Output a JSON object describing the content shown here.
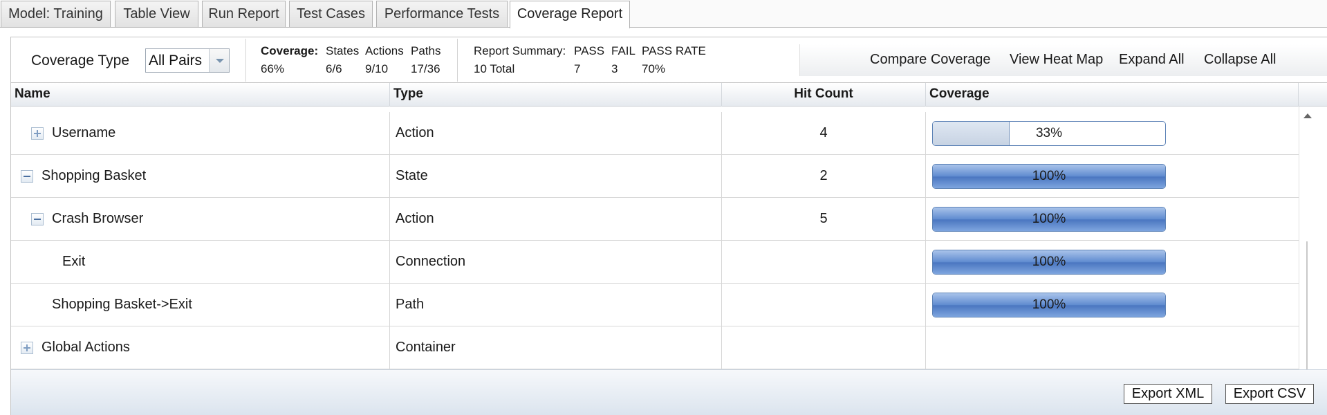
{
  "tabs": [
    {
      "label": "Model: Training"
    },
    {
      "label": "Table View"
    },
    {
      "label": "Run Report"
    },
    {
      "label": "Test Cases"
    },
    {
      "label": "Performance Tests"
    },
    {
      "label": "Coverage Report",
      "active": true
    }
  ],
  "toolbar": {
    "coverage_type_label": "Coverage Type",
    "coverage_type_value": "All Pairs",
    "coverage": {
      "title": "Coverage:",
      "overall": "66%",
      "states_label": "States",
      "states": "6/6",
      "actions_label": "Actions",
      "actions": "9/10",
      "paths_label": "Paths",
      "paths": "17/36"
    },
    "summary": {
      "title": "Report Summary:",
      "total": "10 Total",
      "pass_label": "PASS",
      "pass": "7",
      "fail_label": "FAIL",
      "fail": "3",
      "rate_label": "PASS RATE",
      "rate": "70%"
    },
    "actions": {
      "compare": "Compare Coverage",
      "heatmap": "View Heat Map",
      "expand": "Expand All",
      "collapse": "Collapse All"
    }
  },
  "grid": {
    "columns": {
      "name": "Name",
      "type": "Type",
      "hit": "Hit Count",
      "coverage": "Coverage"
    },
    "rows": [
      {
        "name": "Username",
        "type": "Action",
        "hit": "4",
        "coverage": "33%",
        "coverage_value": 0.33
      },
      {
        "name": "Shopping Basket",
        "type": "State",
        "hit": "2",
        "coverage": "100%",
        "coverage_value": 1.0
      },
      {
        "name": "Crash Browser",
        "type": "Action",
        "hit": "5",
        "coverage": "100%",
        "coverage_value": 1.0
      },
      {
        "name": "Exit",
        "type": "Connection",
        "hit": "",
        "coverage": "100%",
        "coverage_value": 1.0
      },
      {
        "name": "Shopping Basket->Exit",
        "type": "Path",
        "hit": "",
        "coverage": "100%",
        "coverage_value": 1.0
      },
      {
        "name": "Global Actions",
        "type": "Container",
        "hit": "",
        "coverage": "",
        "coverage_value": null
      }
    ]
  },
  "footer": {
    "export_xml": "Export XML",
    "export_csv": "Export CSV"
  }
}
